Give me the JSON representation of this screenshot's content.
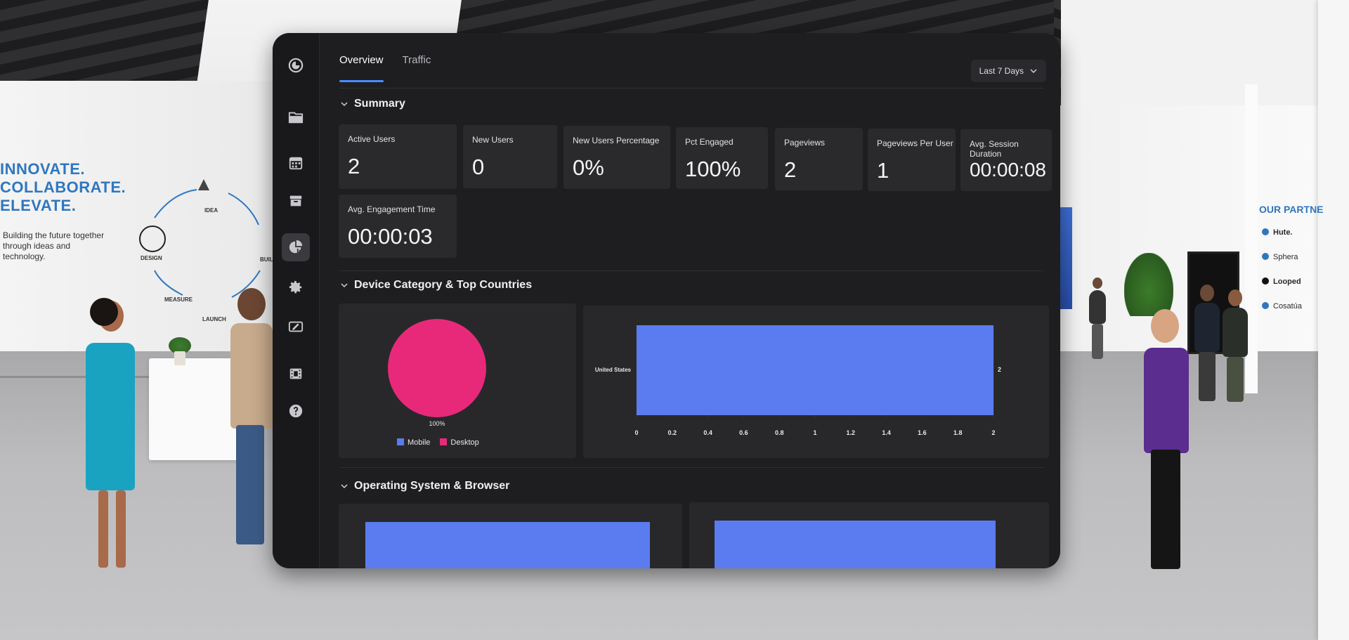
{
  "backdrop": {
    "wall_heading": [
      "INNOVATE.",
      "COLLABORATE.",
      "ELEVATE."
    ],
    "wall_subtitle": "Building the future together through ideas and technology.",
    "cycle_labels": [
      "IDEA",
      "BUILD",
      "LAUNCH",
      "MEASURE",
      "DESIGN"
    ],
    "partners_title": "OUR PARTNE",
    "partners": [
      "Hute.",
      "Sphera",
      "Looped",
      "Cosatúa"
    ]
  },
  "rail": {
    "items": [
      {
        "icon": "logo-icon",
        "active": false
      },
      {
        "icon": "folder-icon",
        "active": false
      },
      {
        "icon": "calendar-grid-icon",
        "active": false
      },
      {
        "icon": "archive-icon",
        "active": false
      },
      {
        "icon": "analytics-pie-icon",
        "active": true
      },
      {
        "icon": "gear-icon",
        "active": false
      },
      {
        "icon": "edit-card-icon",
        "active": false
      },
      {
        "icon": "film-icon",
        "active": false
      },
      {
        "icon": "help-icon",
        "active": false
      }
    ]
  },
  "tabs": [
    {
      "label": "Overview",
      "active": true
    },
    {
      "label": "Traffic",
      "active": false
    }
  ],
  "date_range": {
    "selected": "Last 7 Days"
  },
  "sections": {
    "summary": "Summary",
    "device": "Device Category & Top Countries",
    "os": "Operating System & Browser"
  },
  "metrics": [
    {
      "label": "Active Users",
      "value": "2"
    },
    {
      "label": "New Users",
      "value": "0"
    },
    {
      "label": "New Users Percentage",
      "value": "0%"
    },
    {
      "label": "Pct Engaged",
      "value": "100%"
    },
    {
      "label": "Pageviews",
      "value": "2"
    },
    {
      "label": "Pageviews Per User",
      "value": "1"
    },
    {
      "label": "Avg. Session Duration",
      "value": "00:00:08"
    },
    {
      "label": "Avg. Engagement Time",
      "value": "00:00:03"
    }
  ],
  "colors": {
    "accent": "#4b8bff",
    "bar": "#5b7cf0",
    "mobile": "#5b7cf0",
    "desktop": "#e8297a"
  },
  "chart_data": [
    {
      "type": "pie",
      "title": "",
      "categories": [
        "Mobile",
        "Desktop"
      ],
      "values": [
        0,
        100
      ],
      "slice_label": "100%",
      "legend": [
        "Mobile",
        "Desktop"
      ],
      "legend_position": "bottom"
    },
    {
      "type": "bar",
      "orientation": "horizontal",
      "categories": [
        "United States"
      ],
      "values": [
        2
      ],
      "value_labels": [
        "2"
      ],
      "xlim": [
        0,
        2
      ],
      "xticks": [
        "0",
        "0.2",
        "0.4",
        "0.6",
        "0.8",
        "1",
        "1.2",
        "1.4",
        "1.6",
        "1.8",
        "2"
      ],
      "grid": true
    }
  ]
}
